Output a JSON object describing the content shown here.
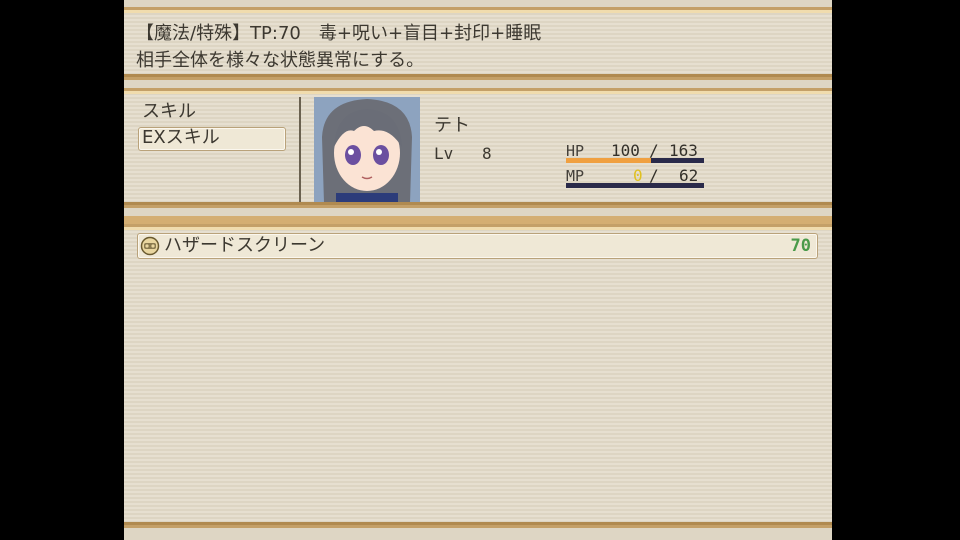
{
  "help": {
    "line1": "【魔法/特殊】TP:70　毒+呪い+盲目+封印+睡眠",
    "line2": "相手全体を様々な状態異常にする。"
  },
  "skill_types": [
    {
      "label": "スキル",
      "selected": false
    },
    {
      "label": "EXスキル",
      "selected": true
    }
  ],
  "actor": {
    "name": "テト",
    "level_label": "Lv",
    "level": "8",
    "hp_label": "HP",
    "hp": "100",
    "mhp": "163",
    "hp_ratio": 0.613,
    "mp_label": "MP",
    "mp": "0",
    "mmp": "62",
    "mp_ratio": 0.0,
    "slash": "/"
  },
  "skills": [
    {
      "name": "ハザードスクリーン",
      "cost": "70",
      "icon": "hazard-skill-icon",
      "selected": true
    }
  ],
  "colors": {
    "hp_gauge": "#f0a040",
    "mp_gauge": "#f0e060",
    "gauge_bg": "#2a2a4a",
    "tp_cost": "#4a9a4a",
    "frame": "#c4a068"
  }
}
